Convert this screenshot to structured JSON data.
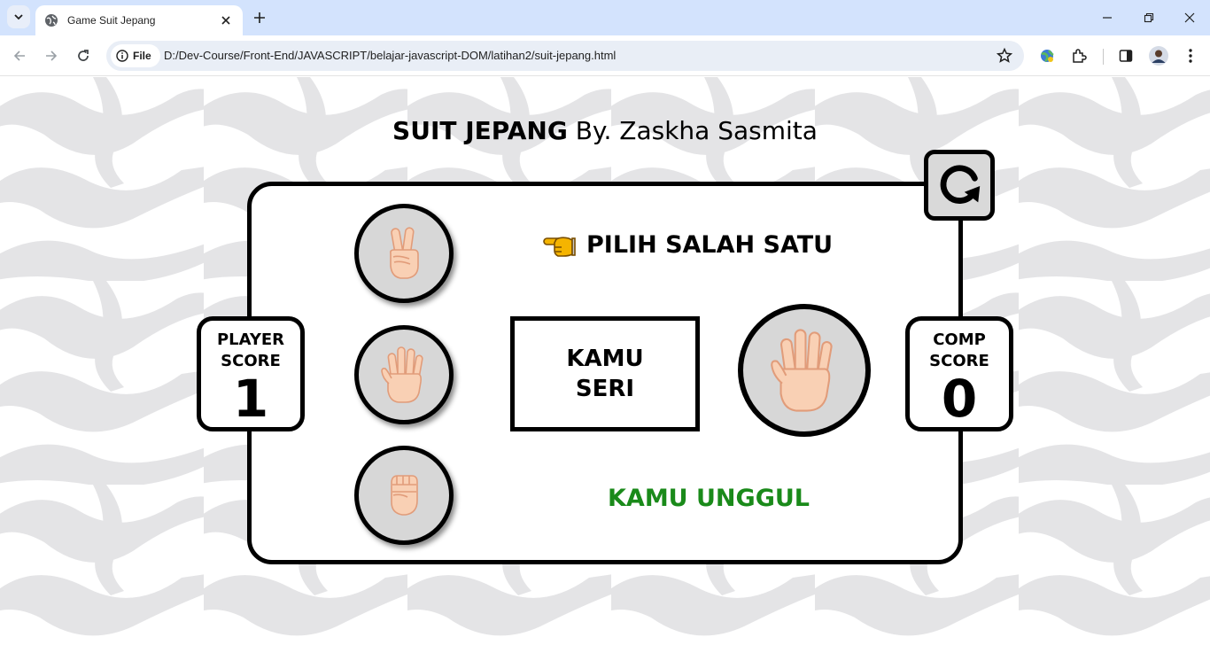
{
  "browser": {
    "tab_title": "Game Suit Jepang",
    "site_chip_label": "File",
    "url": "D:/Dev-Course/Front-End/JAVASCRIPT/belajar-javascript-DOM/latihan2/suit-jepang.html"
  },
  "game": {
    "title_bold": "SUIT JEPANG",
    "title_rest": " By. Zaskha Sasmita",
    "prompt": "PILIH SALAH SATU",
    "player_score_label_1": "PLAYER",
    "player_score_label_2": "SCORE",
    "player_score": "1",
    "comp_score_label_1": "COMP",
    "comp_score_label_2": "SCORE",
    "comp_score": "0",
    "result": "KAMU SERI",
    "status": "KAMU UNGGUL",
    "status_color": "#1a8a1a",
    "choices": [
      "scissors",
      "paper",
      "rock"
    ],
    "computer_choice": "paper"
  },
  "icons": {
    "prompt_icon": "pointing-hand-icon",
    "refresh_icon": "refresh-icon"
  }
}
